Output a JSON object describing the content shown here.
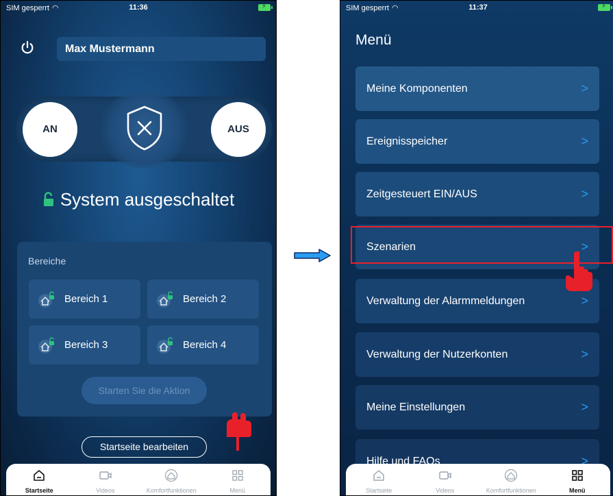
{
  "left_screen": {
    "status": {
      "carrier": "SIM gesperrt",
      "time": "11:36"
    },
    "user_name": "Max Mustermann",
    "arm_on_label": "AN",
    "arm_off_label": "AUS",
    "system_status": "System ausgeschaltet",
    "areas": {
      "title": "Bereiche",
      "items": [
        "Bereich 1",
        "Bereich 2",
        "Bereich 3",
        "Bereich 4"
      ],
      "start_action": "Starten Sie die Aktion"
    },
    "edit_home": "Startseite bearbeiten",
    "tabs": [
      {
        "label": "Startseite",
        "icon": "home-icon",
        "active": true
      },
      {
        "label": "Videos",
        "icon": "video-icon",
        "active": false
      },
      {
        "label": "Komfortfunktionen",
        "icon": "comfort-icon",
        "active": false
      },
      {
        "label": "Menü",
        "icon": "menu-grid-icon",
        "active": false
      }
    ]
  },
  "right_screen": {
    "status": {
      "carrier": "SIM gesperrt",
      "time": "11:37"
    },
    "title": "Menü",
    "menu_items": [
      "Meine Komponenten",
      "Ereignisspeicher",
      "Zeitgesteuert EIN/AUS",
      "Szenarien",
      "Verwaltung der Alarmmeldungen",
      "Verwaltung der Nutzerkonten",
      "Meine Einstellungen",
      "Hilfe und FAQs"
    ],
    "chevron": ">",
    "tabs": [
      {
        "label": "Startseite",
        "icon": "home-icon",
        "active": false
      },
      {
        "label": "Videos",
        "icon": "video-icon",
        "active": false
      },
      {
        "label": "Komfortfunktionen",
        "icon": "comfort-icon",
        "active": false
      },
      {
        "label": "Menü",
        "icon": "menu-grid-icon",
        "active": true
      }
    ]
  },
  "colors": {
    "accent": "#2c98f0",
    "highlight": "#e8202a",
    "pointer": "#e8202a",
    "lock_green": "#2ec27e"
  }
}
